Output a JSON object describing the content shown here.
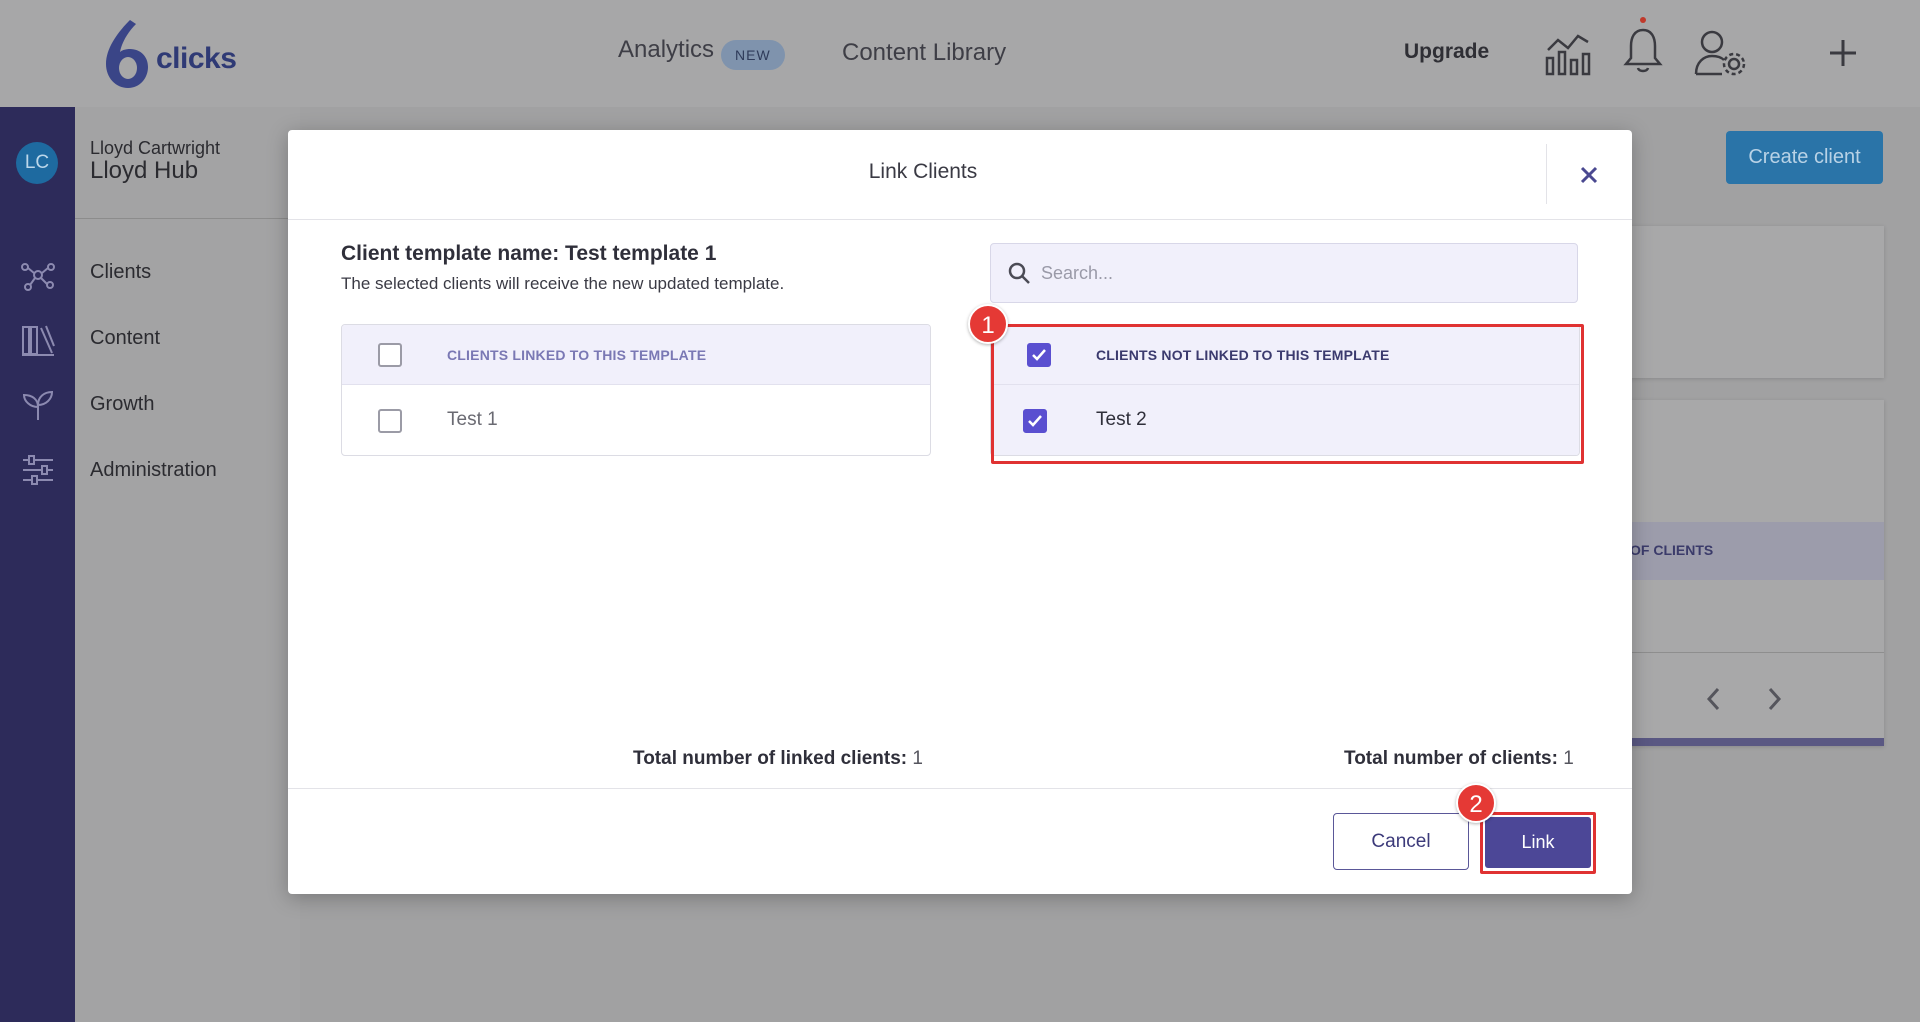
{
  "topbar": {
    "logo_text": "clicks",
    "nav_analytics": "Analytics",
    "nav_analytics_badge": "NEW",
    "nav_content_library": "Content Library",
    "upgrade": "Upgrade"
  },
  "account": {
    "initials": "LC",
    "user_name": "Lloyd Cartwright",
    "hub_name": "Lloyd Hub"
  },
  "subnav": {
    "items": [
      {
        "label": "Clients",
        "icon": "network-icon"
      },
      {
        "label": "Content",
        "icon": "library-icon"
      },
      {
        "label": "Growth",
        "icon": "sprout-icon"
      },
      {
        "label": "Administration",
        "icon": "sliders-icon"
      }
    ]
  },
  "background": {
    "create_client": "Create client",
    "card_column_fragment": "OF CLIENTS"
  },
  "modal": {
    "title": "Link Clients",
    "template_name": "Client template name: Test template 1",
    "description": "The selected clients will receive the new updated template.",
    "search_placeholder": "Search...",
    "linked": {
      "header": "CLIENTS LINKED TO THIS TEMPLATE",
      "header_checked": false,
      "rows": [
        {
          "name": "Test 1",
          "checked": false
        }
      ],
      "total_label": "Total number of linked clients:",
      "total_value": "1"
    },
    "not_linked": {
      "header": "CLIENTS NOT LINKED TO THIS TEMPLATE",
      "header_checked": true,
      "rows": [
        {
          "name": "Test 2",
          "checked": true
        }
      ],
      "total_label": "Total number of clients:",
      "total_value": "1"
    },
    "cancel": "Cancel",
    "link": "Link"
  },
  "annotations": {
    "step1": "1",
    "step2": "2"
  },
  "colors": {
    "accent": "#5a4fd0",
    "primary_button": "#4c4797",
    "annotation": "#e53935",
    "sidebar": "#2d2b5a"
  }
}
